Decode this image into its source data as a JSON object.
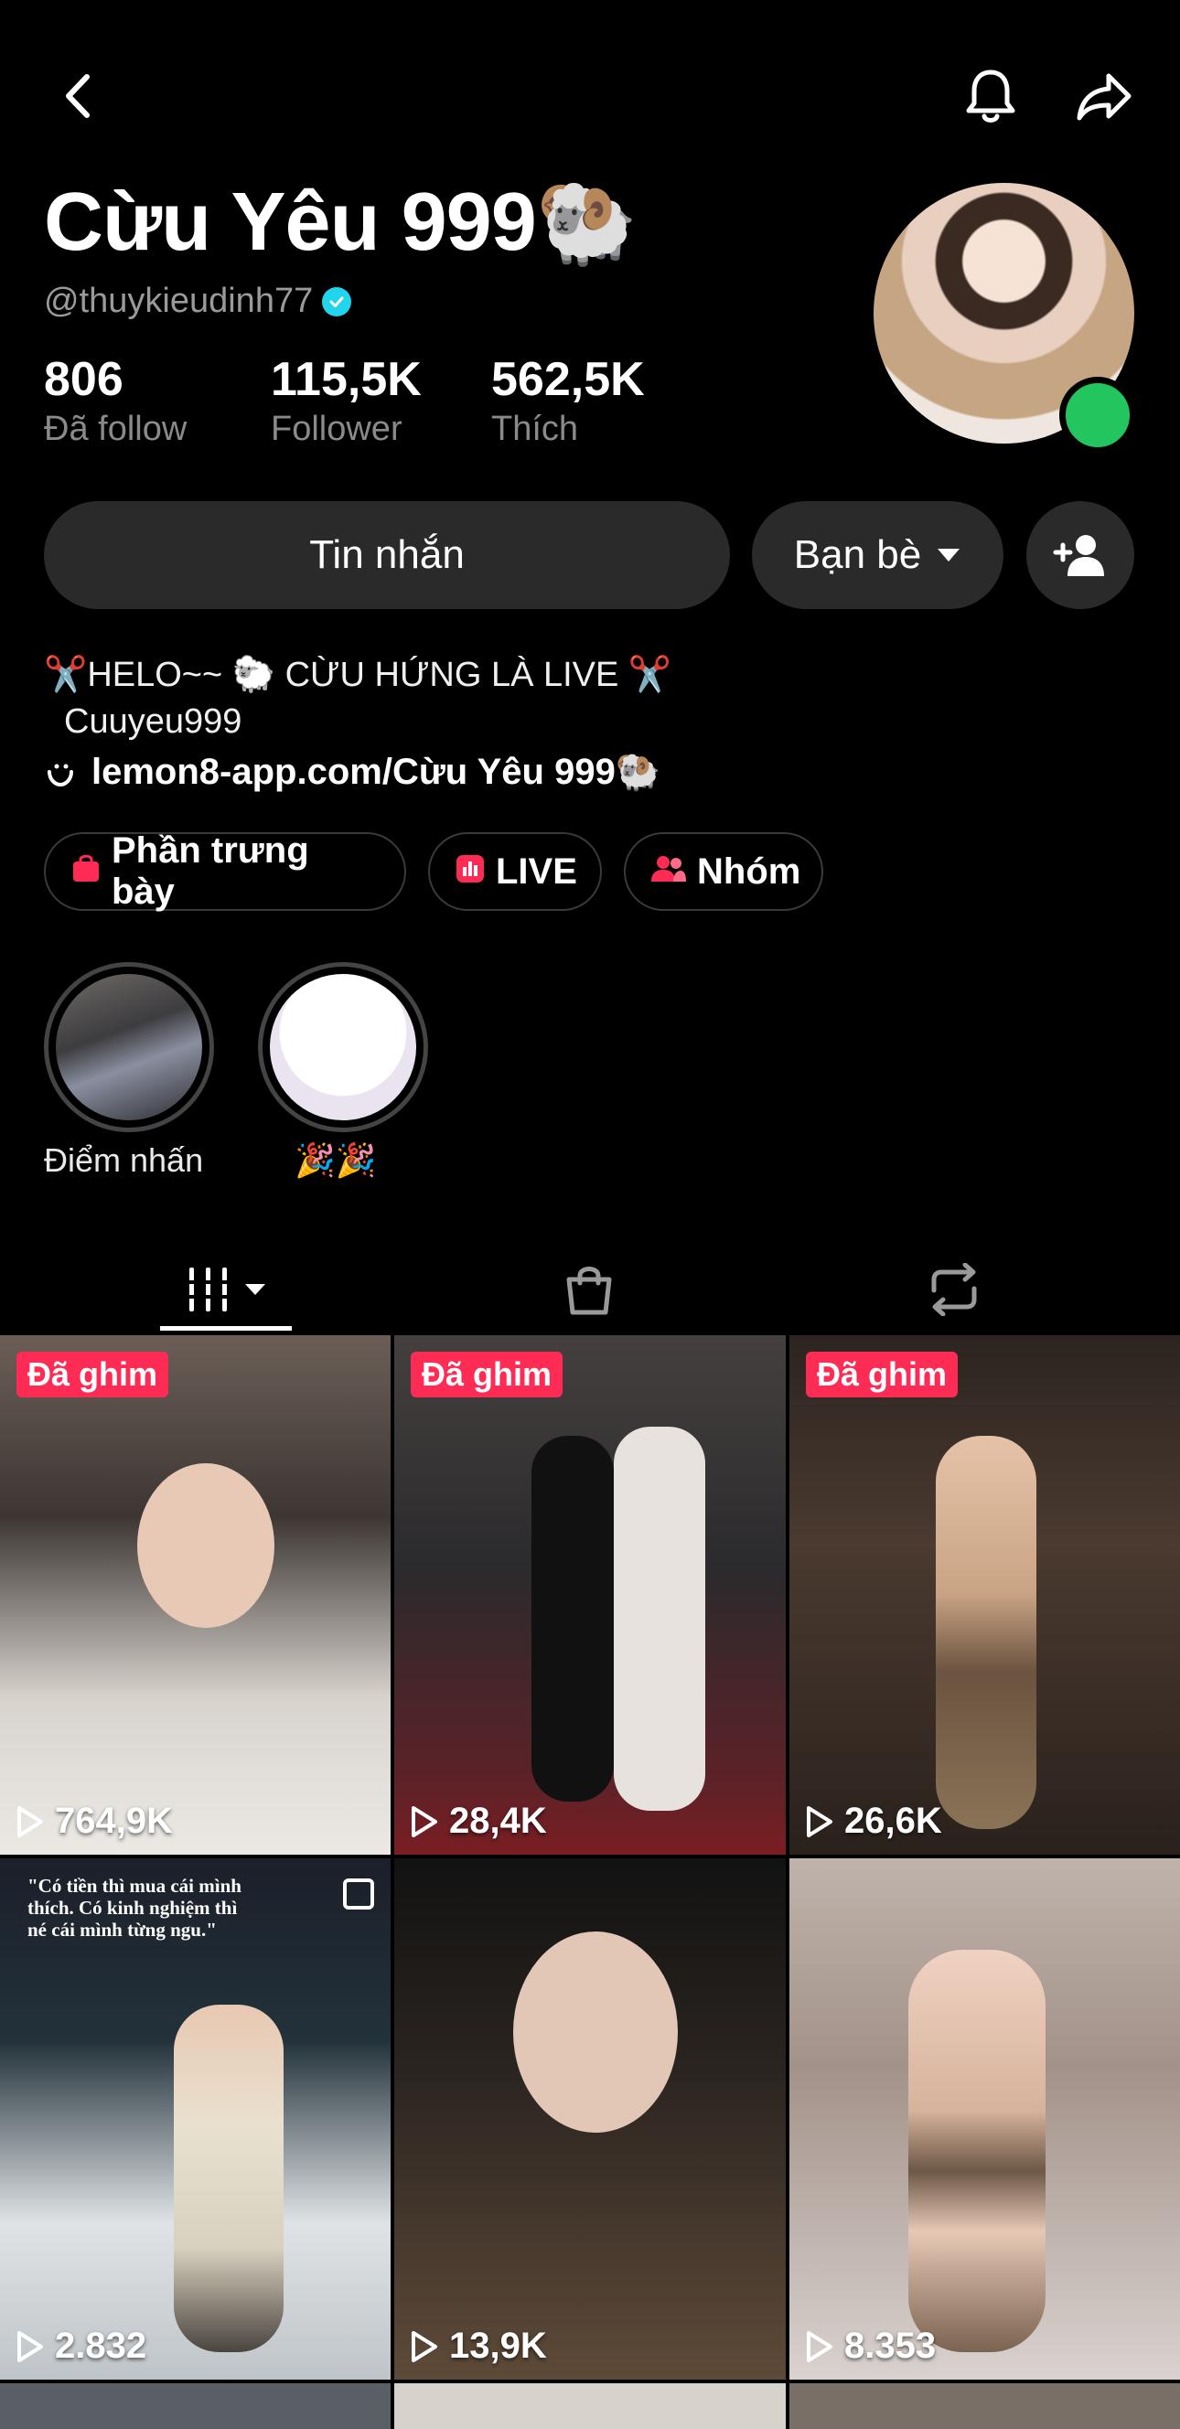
{
  "header": {
    "back_icon": "chevron-left-icon",
    "bell_icon": "bell-icon",
    "share_icon": "share-arrow-icon"
  },
  "profile": {
    "display_name": "Cừu Yêu 999🐏",
    "handle": "@thuykieudinh77",
    "verified": true,
    "stats": [
      {
        "value": "806",
        "label": "Đã follow"
      },
      {
        "value": "115,5K",
        "label": "Follower"
      },
      {
        "value": "562,5K",
        "label": "Thích"
      }
    ]
  },
  "actions": {
    "message_label": "Tin nhắn",
    "friends_label": "Bạn bè",
    "add_friend_icon": "add-user-icon"
  },
  "bio": {
    "line1": "✂️HELO~~  🐑 CỪU HỨNG LÀ LIVE ✂️",
    "line2": "Cuuyeu999",
    "link": "lemon8-app.com/Cừu Yêu 999🐏"
  },
  "pills": [
    {
      "label": "Phần trưng bày",
      "icon": "shopping-bag-icon",
      "color": "#fe2c55"
    },
    {
      "label": "LIVE",
      "icon": "live-icon",
      "color": "#fe2c55"
    },
    {
      "label": "Nhóm",
      "icon": "group-icon",
      "color": "#fe2c55"
    }
  ],
  "highlights": [
    {
      "label": "Điểm nhấn"
    },
    {
      "label": "🎉🎉"
    }
  ],
  "tabs": [
    {
      "icon": "videos-grid-icon",
      "active": true
    },
    {
      "icon": "shop-bag-icon",
      "active": false
    },
    {
      "icon": "repost-icon",
      "active": false
    }
  ],
  "videos": [
    {
      "pinned": true,
      "pinned_label": "Đã ghim",
      "views": "764,9K"
    },
    {
      "pinned": true,
      "pinned_label": "Đã ghim",
      "views": "28,4K"
    },
    {
      "pinned": true,
      "pinned_label": "Đã ghim",
      "views": "26,6K"
    },
    {
      "pinned": false,
      "views": "2.832",
      "caption": "\"Có tiền thì mua cái mình thích. Có kinh nghiệm thì né cái mình từng ngu.\""
    },
    {
      "pinned": false,
      "views": "13,9K"
    },
    {
      "pinned": false,
      "views": "8.353"
    }
  ],
  "colors": {
    "background": "#000000",
    "accent": "#fe2c55",
    "online": "#22c55e",
    "verified": "#20d5ec"
  }
}
